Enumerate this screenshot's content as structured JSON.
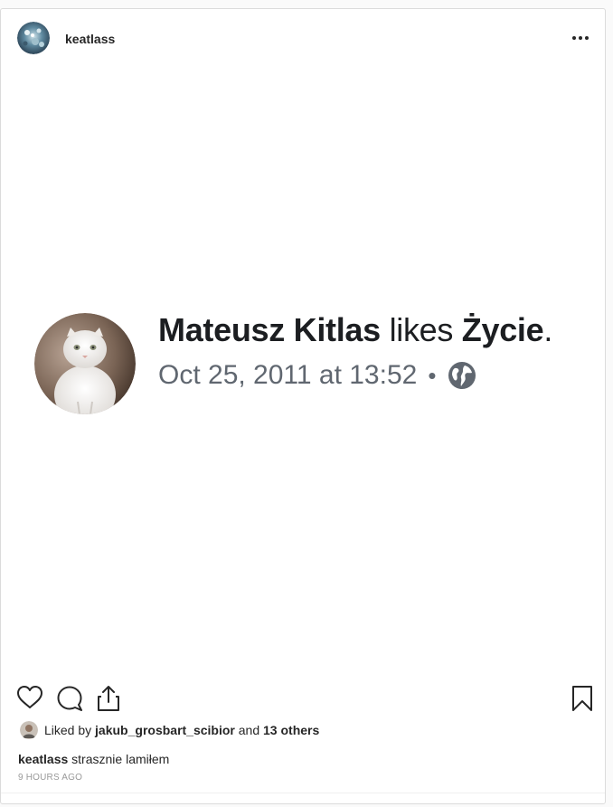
{
  "post": {
    "username": "keatlass",
    "more_icon": "more-horizontal-icon",
    "media": {
      "author": "Mateusz Kitlas",
      "verb": " likes ",
      "page": "Życie",
      "period": ".",
      "date": "Oct 25, 2011 at 13:52",
      "separator": "•",
      "privacy_icon": "globe-icon"
    },
    "actions": {
      "like_icon": "heart-icon",
      "comment_icon": "comment-icon",
      "share_icon": "share-icon",
      "save_icon": "bookmark-icon"
    },
    "likes": {
      "prefix": "Liked by",
      "user": "jakub_grosbart_scibior",
      "conjunction": "and",
      "others": "13 others"
    },
    "caption": {
      "username": "keatlass",
      "text": "strasznie lamiłem"
    },
    "timestamp": "9 HOURS AGO"
  },
  "colors": {
    "border": "#dbdbdb",
    "text": "#262626",
    "muted": "#999999",
    "fb_text": "#1c1e21",
    "fb_muted": "#606770"
  }
}
